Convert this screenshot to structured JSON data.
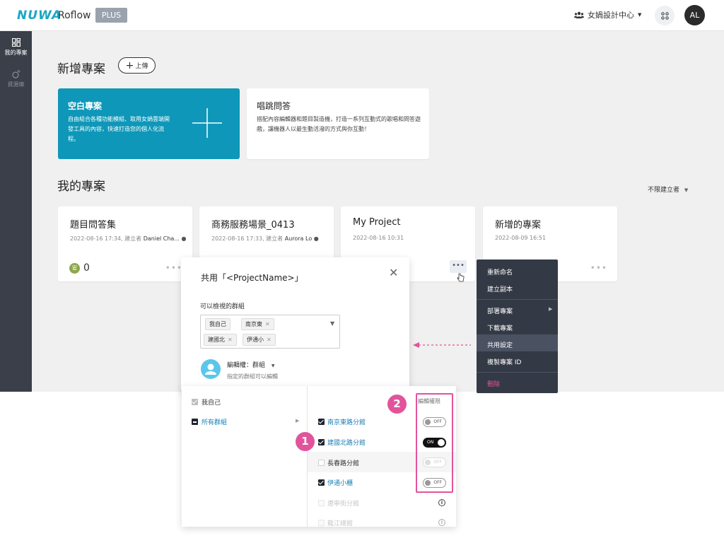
{
  "topbar": {
    "logo": "NUWA",
    "app_name": "Roflow",
    "plan_badge": "PLUS",
    "org_name": "女媧設計中心",
    "avatar_initials": "AL"
  },
  "sidebar": {
    "items": [
      {
        "label": "我的專案",
        "icon": "dashboard-icon"
      },
      {
        "label": "資源庫",
        "icon": "resource-icon"
      }
    ]
  },
  "new_project": {
    "title": "新增專案",
    "upload_label": "上傳",
    "cards": [
      {
        "title": "空白專案",
        "desc": "自由組合各種功能模組、取用女媧雲端開發工具的內容，快速打造您的個人化流程。"
      },
      {
        "title": "唱跳問答",
        "desc": "搭配內容編輯器和題目製造機，打造一系列互動式的歌唱和問答遊戲，讓機器人以最生動活潑的方式與你互動！"
      }
    ]
  },
  "my_projects": {
    "title": "我的專案",
    "filter": "不限建立者",
    "cards": [
      {
        "name": "題目問答集",
        "meta": "2022-08-16 17:34, 建立者 ",
        "owner": "Daniel Cha...",
        "score": "0"
      },
      {
        "name": "商務服務場景_0413",
        "meta": "2022-08-16 17:33, 建立者 ",
        "owner": "Aurora Lo"
      },
      {
        "name": "My Project",
        "meta": "2022-08-16 10:31",
        "owner": ""
      },
      {
        "name": "新增的專案",
        "meta": "2022-08-09 16:51",
        "owner": ""
      }
    ]
  },
  "share_dialog": {
    "title": "共用「<ProjectName>」",
    "view_label": "可以檢視的群組",
    "tags": [
      "我自己",
      "南京東",
      "建國北",
      "伊通小"
    ],
    "permission_label": "編輯權：群組",
    "permission_desc": "指定的群組可以編輯"
  },
  "context_menu": {
    "items": [
      "重新命名",
      "建立副本",
      "部署專案",
      "下載專案",
      "共用設定",
      "複製專案 ID",
      "刪除"
    ]
  },
  "groups_panel": {
    "left_items": [
      {
        "label": "我自己",
        "state": "gray"
      },
      {
        "label": "所有群組",
        "state": "minus"
      }
    ],
    "perm_header": "編輯權限",
    "branches": [
      {
        "label": "南京東路分館",
        "checked": true,
        "toggle": "OFF"
      },
      {
        "label": "建國北路分館",
        "checked": true,
        "toggle": "ON"
      },
      {
        "label": "長春路分館",
        "checked": false,
        "toggle": "OFF"
      },
      {
        "label": "伊通小櫃",
        "checked": true,
        "toggle": "OFF"
      },
      {
        "label": "遼寧街分館",
        "checked": false,
        "toggle": "info"
      },
      {
        "label": "龍江總館",
        "checked": false,
        "toggle": "info"
      }
    ]
  },
  "annotations": {
    "step1": "1",
    "step2": "2"
  },
  "colors": {
    "brand": "#19a7c4",
    "accent_pink": "#e1549b",
    "sidebar": "#3a3f4a",
    "link": "#1a7fb5"
  }
}
